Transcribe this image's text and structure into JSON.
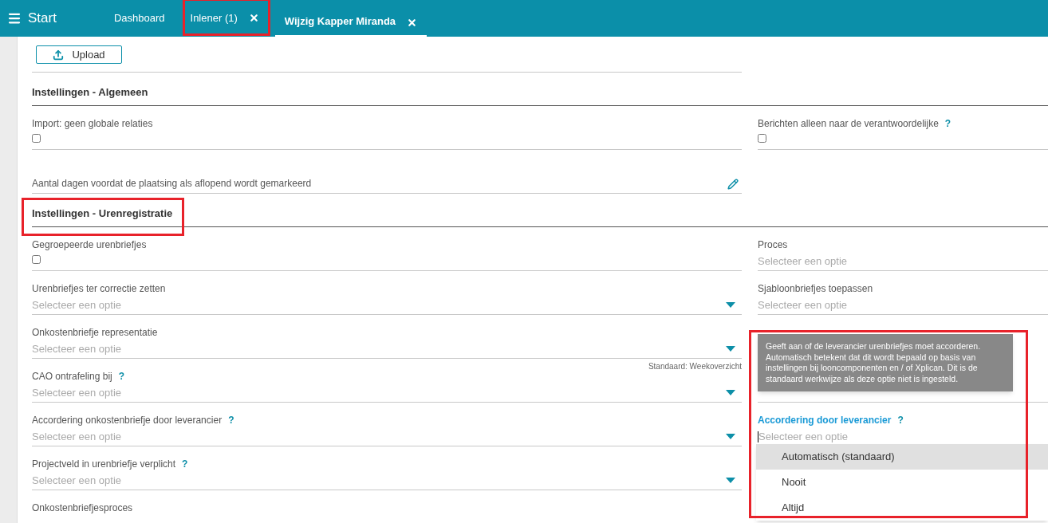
{
  "header": {
    "menu_label": "Start",
    "tabs": [
      {
        "label": "Dashboard",
        "closable": false,
        "selected": false
      },
      {
        "label": "Inlener (1)",
        "closable": true,
        "selected": false
      },
      {
        "label": "Wijzig Kapper Miranda",
        "closable": true,
        "selected": true
      }
    ]
  },
  "upload": {
    "button": "Upload"
  },
  "sections": [
    {
      "title": "Instellingen - Algemeen",
      "rows": [
        {
          "left": {
            "kind": "checkbox",
            "label": "Import: geen globale relaties",
            "checked": false
          },
          "right": {
            "kind": "checkbox",
            "label": "Berichten alleen naar de verantwoordelijke",
            "help": true,
            "checked": false
          }
        },
        {
          "left": {
            "kind": "text",
            "label": "Aantal dagen voordat de plaatsing als aflopend wordt gemarkeerd"
          }
        }
      ]
    },
    {
      "title": "Instellingen - Urenregistratie",
      "rows": [
        {
          "left": {
            "kind": "checkbox",
            "label": "Gegroepeerde urenbriefjes",
            "checked": false
          },
          "right": {
            "kind": "select",
            "label": "Proces",
            "placeholder": "Selecteer een optie",
            "focused": false
          }
        },
        {
          "left": {
            "kind": "select",
            "label": "Urenbriefjes ter correctie zetten",
            "placeholder": "Selecteer een optie",
            "arrow": true,
            "focused": false
          },
          "right": {
            "kind": "select",
            "label": "Sjabloonbriefjes toepassen",
            "placeholder": "Selecteer een optie",
            "focused": false
          }
        },
        {
          "left": {
            "kind": "select",
            "label": "Onkostenbriefje representatie",
            "placeholder": "Selecteer een optie",
            "arrow": true,
            "focused": false,
            "hint": "Standaard: Weekoverzicht"
          }
        },
        {
          "left": {
            "kind": "select",
            "label": "CAO ontrafeling bij",
            "help": true,
            "placeholder": "Selecteer een optie",
            "arrow": true,
            "focused": false
          },
          "right": {
            "kind": "line"
          }
        },
        {
          "left": {
            "kind": "select",
            "label": "Accordering onkostenbriefje door leverancier",
            "help": true,
            "placeholder": "Selecteer een optie",
            "arrow": true,
            "focused": false
          },
          "right": {
            "kind": "select",
            "label": "Accordering door leverancier",
            "help": true,
            "placeholder": "Selecteer een optie",
            "focused": true
          }
        },
        {
          "left": {
            "kind": "select",
            "label": "Projectveld in urenbriefje verplicht",
            "help": true,
            "placeholder": "Selecteer een optie",
            "arrow": true,
            "focused": false
          }
        },
        {
          "left": {
            "kind": "label",
            "label": "Onkostenbriefjesproces"
          }
        }
      ]
    }
  ],
  "help_mark": "?",
  "tooltip": {
    "text": "Geeft aan of de leverancier urenbriefjes moet accorderen. Automatisch betekent dat dit wordt bepaald op basis van instellingen bij looncomponenten en / of Xplican. Dit is de standaard werkwijze als deze optie niet is ingesteld."
  },
  "dropdown": {
    "options": [
      {
        "label": "Automatisch (standaard)",
        "selected": true
      },
      {
        "label": "Nooit",
        "selected": false
      },
      {
        "label": "Altijd",
        "selected": false
      }
    ]
  }
}
